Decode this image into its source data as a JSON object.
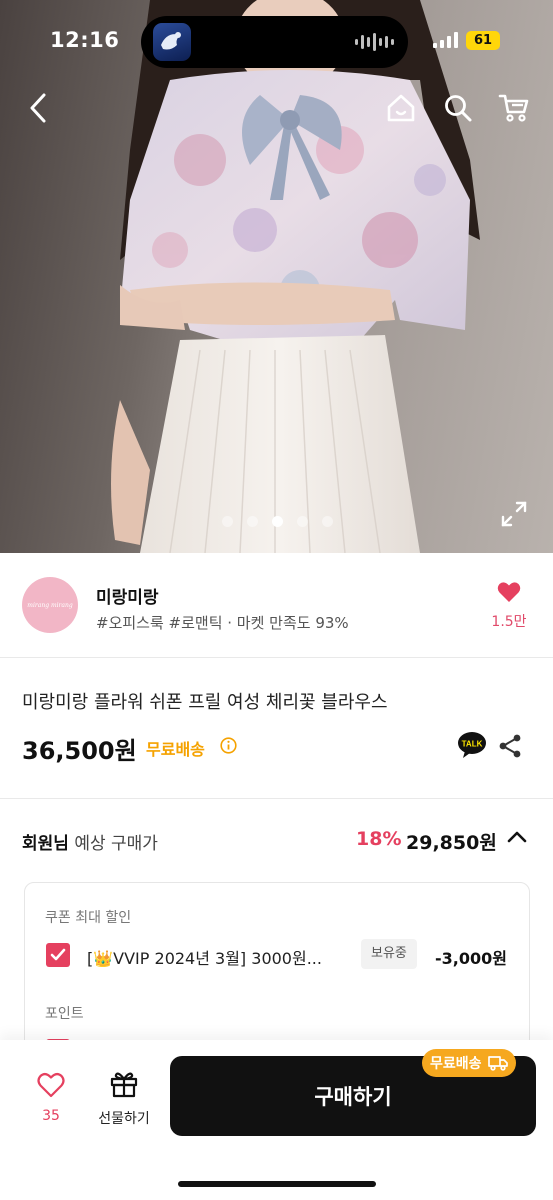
{
  "status_bar": {
    "time": "12:16",
    "battery": "61"
  },
  "hero": {
    "description_icon": "product-photo",
    "slide_count": 5,
    "active_slide": 3
  },
  "seller": {
    "name": "미랑미랑",
    "tags": "#오피스룩 #로맨틱 · 마켓 만족도 93%",
    "likes": "1.5만"
  },
  "product": {
    "title": "미랑미랑 플라워 쉬폰 프릴 여성 체리꽃 블라우스",
    "price": "36,500원",
    "shipping": "무료배송",
    "talk_label": "TALK"
  },
  "member_price": {
    "label_bold": "회원님",
    "label_rest": "예상 구매가",
    "discount": "18%",
    "price": "29,850원"
  },
  "discount_box": {
    "coupon_heading": "쿠폰 최대 할인",
    "coupon_name": "[👑VVIP 2024년 3월] 3000원...",
    "coupon_badge": "보유중",
    "coupon_amount": "-3,000원",
    "point_heading": "포인트"
  },
  "bottom_bar": {
    "like_count": "35",
    "gift_label": "선물하기",
    "buy_label": "구매하기",
    "free_shipping_tag": "무료배송"
  },
  "colors": {
    "accent_pink": "#e5405f",
    "shipping_orange": "#f5a200",
    "buy_button": "#111111"
  }
}
